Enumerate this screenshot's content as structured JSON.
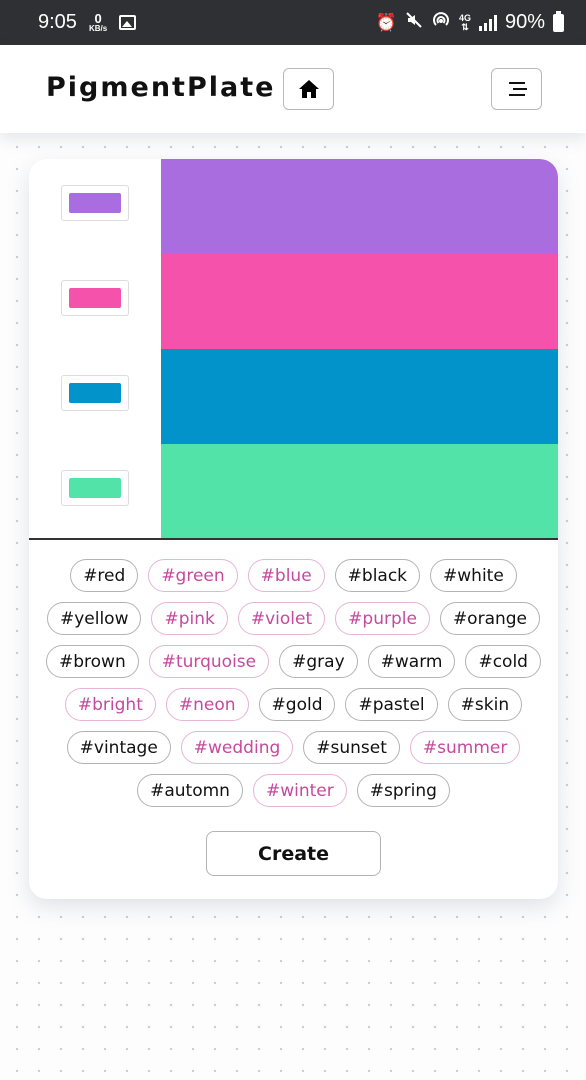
{
  "status_bar": {
    "time": "9:05",
    "net_speed_value": "0",
    "net_speed_unit": "KB/s",
    "network_type": "4G",
    "battery": "90%"
  },
  "header": {
    "app_title": "PigmentPlate",
    "home_icon": "home-icon",
    "menu_icon": "hamburger-menu-icon"
  },
  "palette": {
    "colors": [
      "#a96ddf",
      "#f553ab",
      "#0393cb",
      "#52e3a8"
    ]
  },
  "tags": [
    {
      "label": "#red",
      "selected": false
    },
    {
      "label": "#green",
      "selected": true
    },
    {
      "label": "#blue",
      "selected": true
    },
    {
      "label": "#black",
      "selected": false
    },
    {
      "label": "#white",
      "selected": false
    },
    {
      "label": "#yellow",
      "selected": false
    },
    {
      "label": "#pink",
      "selected": true
    },
    {
      "label": "#violet",
      "selected": true
    },
    {
      "label": "#purple",
      "selected": true
    },
    {
      "label": "#orange",
      "selected": false
    },
    {
      "label": "#brown",
      "selected": false
    },
    {
      "label": "#turquoise",
      "selected": true
    },
    {
      "label": "#gray",
      "selected": false
    },
    {
      "label": "#warm",
      "selected": false
    },
    {
      "label": "#cold",
      "selected": false
    },
    {
      "label": "#bright",
      "selected": true
    },
    {
      "label": "#neon",
      "selected": true
    },
    {
      "label": "#gold",
      "selected": false
    },
    {
      "label": "#pastel",
      "selected": false
    },
    {
      "label": "#skin",
      "selected": false
    },
    {
      "label": "#vintage",
      "selected": false
    },
    {
      "label": "#wedding",
      "selected": true
    },
    {
      "label": "#sunset",
      "selected": false
    },
    {
      "label": "#summer",
      "selected": true
    },
    {
      "label": "#automn",
      "selected": false
    },
    {
      "label": "#winter",
      "selected": true
    },
    {
      "label": "#spring",
      "selected": false
    }
  ],
  "create_label": "Create",
  "colors": {
    "selected_tag_text": "#c5499e",
    "selected_tag_border": "#e6b4d6",
    "status_bar_bg": "#2f3033"
  }
}
